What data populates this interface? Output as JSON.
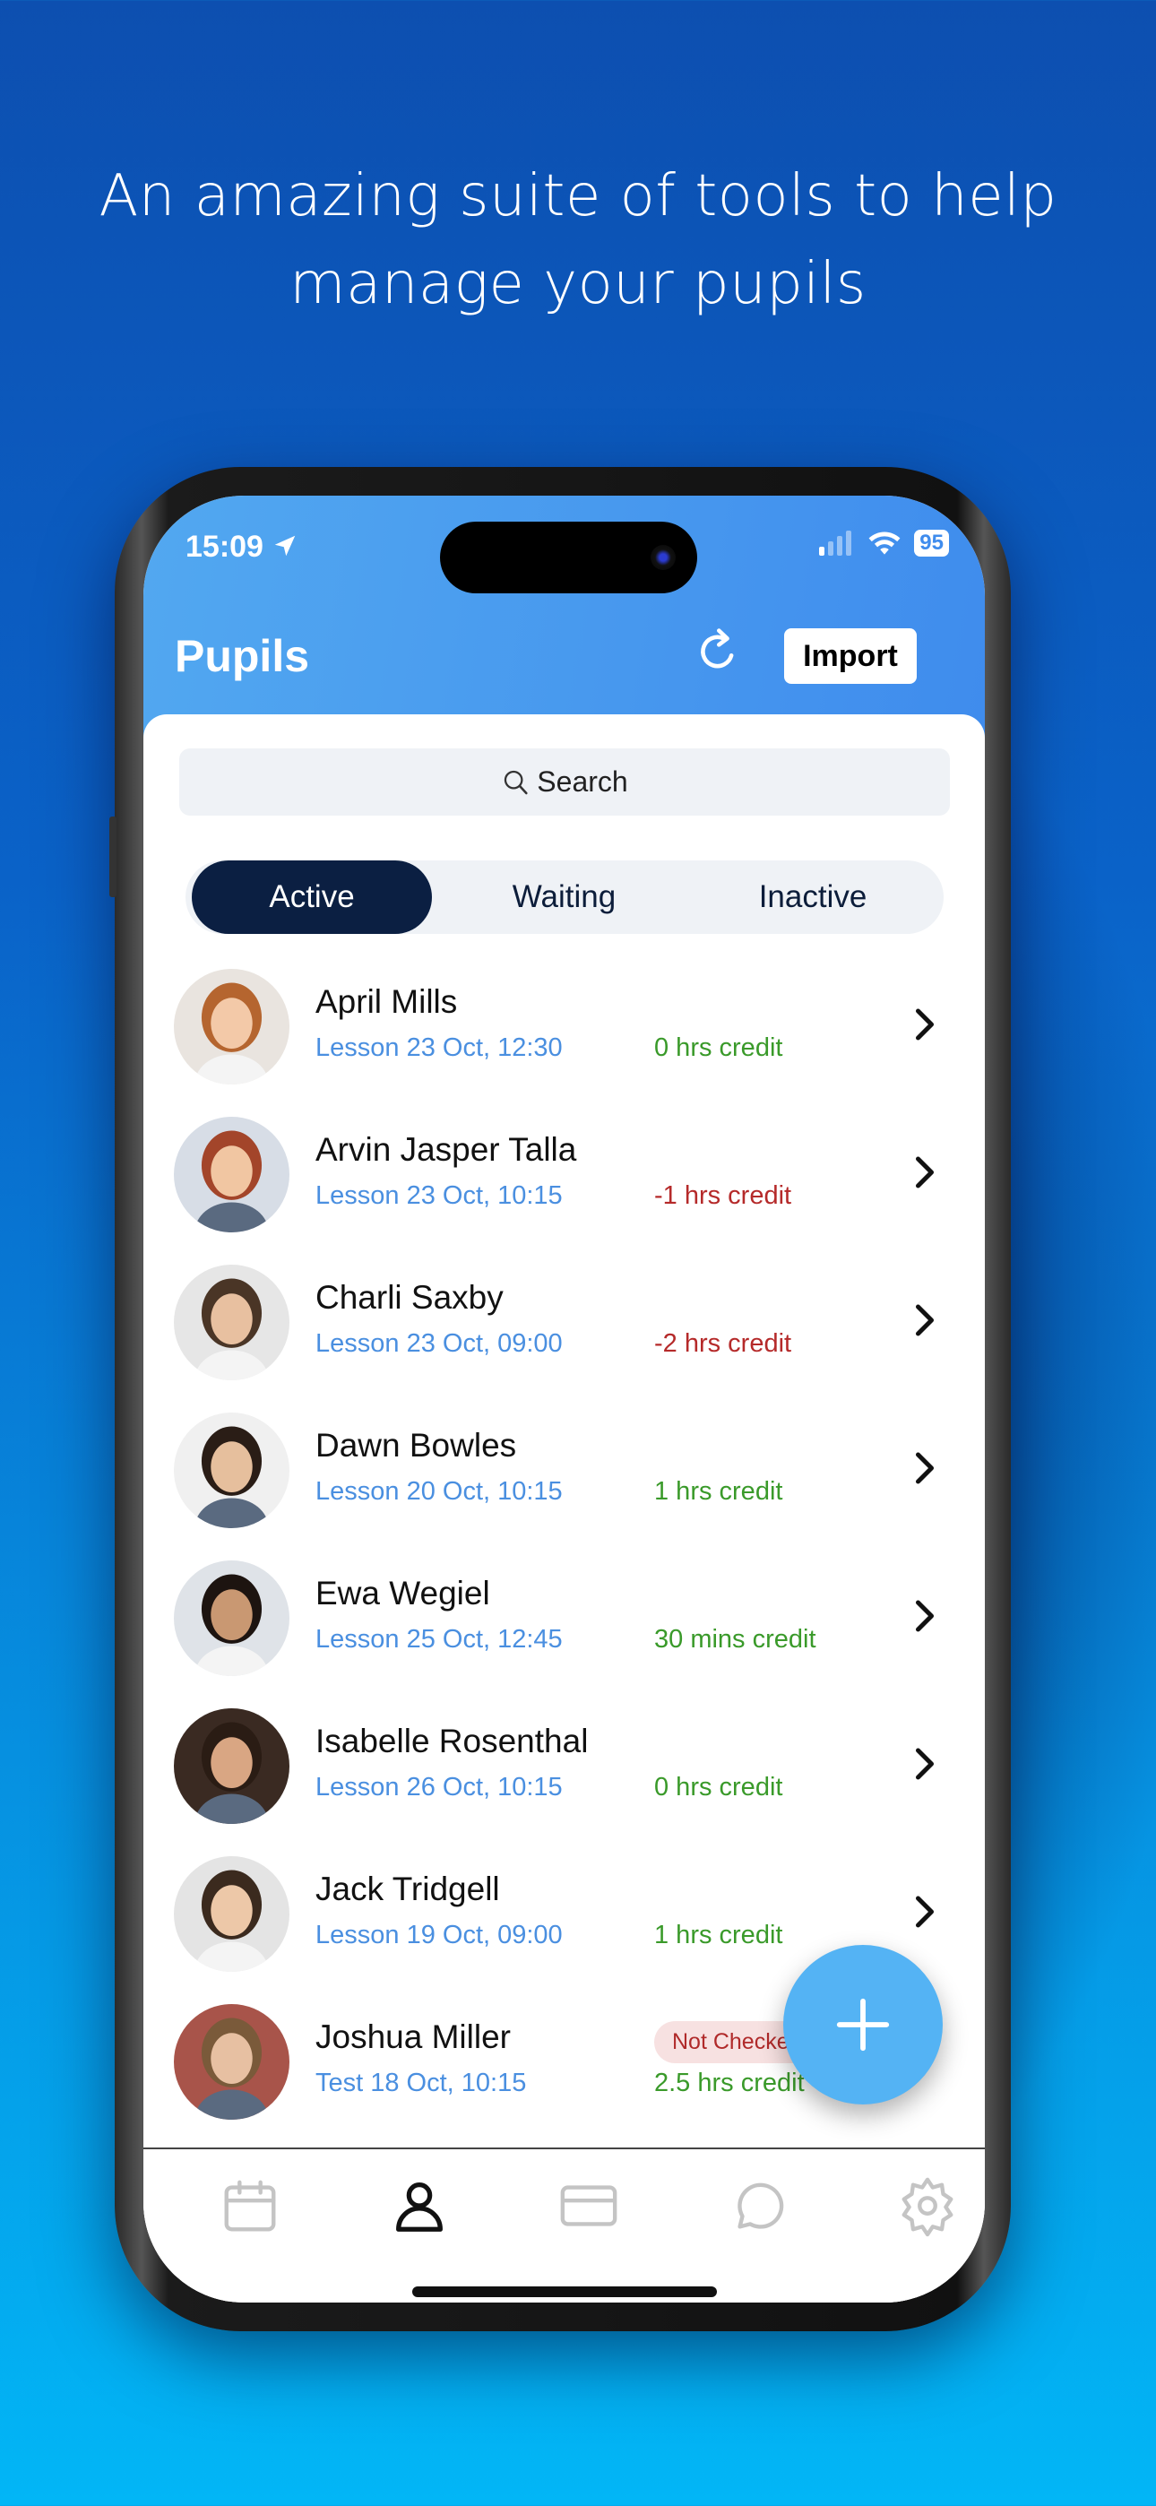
{
  "headline": {
    "line1": "An amazing suite of tools to help",
    "line2": "manage your pupils"
  },
  "status_bar": {
    "time": "15:09",
    "battery": "95"
  },
  "header": {
    "title": "Pupils",
    "import_label": "Import"
  },
  "search": {
    "placeholder": "Search"
  },
  "segments": {
    "items": [
      "Active",
      "Waiting",
      "Inactive"
    ],
    "selected": "Active"
  },
  "pupils": [
    {
      "name": "April Mills",
      "lesson": "Lesson 23 Oct, 12:30",
      "credit": "0 hrs credit",
      "credit_color": "#3a9a2a"
    },
    {
      "name": "Arvin Jasper Talla",
      "lesson": "Lesson 23 Oct, 10:15",
      "credit": "-1 hrs credit",
      "credit_color": "#b52a2a"
    },
    {
      "name": "Charli Saxby",
      "lesson": "Lesson 23 Oct, 09:00",
      "credit": "-2 hrs credit",
      "credit_color": "#b52a2a"
    },
    {
      "name": "Dawn Bowles",
      "lesson": "Lesson 20 Oct, 10:15",
      "credit": "1 hrs credit",
      "credit_color": "#3a9a2a"
    },
    {
      "name": "Ewa Wegiel",
      "lesson": "Lesson 25 Oct, 12:45",
      "credit": "30 mins credit",
      "credit_color": "#3a9a2a"
    },
    {
      "name": "Isabelle Rosenthal",
      "lesson": "Lesson 26 Oct, 10:15",
      "credit": "0 hrs credit",
      "credit_color": "#3a9a2a"
    },
    {
      "name": "Jack Tridgell",
      "lesson": "Lesson 19 Oct, 09:00",
      "credit": "1 hrs credit",
      "credit_color": "#3a9a2a"
    },
    {
      "name": "Joshua Miller",
      "lesson": "Test 18 Oct, 10:15",
      "credit": "2.5 hrs credit",
      "credit_color": "#3a9a2a",
      "badge": "Not Checked"
    }
  ],
  "tabbar": {
    "icons": [
      "calendar-icon",
      "person-icon",
      "card-icon",
      "chat-icon",
      "gear-icon"
    ],
    "selected": "person-icon"
  },
  "colors": {
    "header": "#4a9aee",
    "active_segment": "#0b1f42",
    "fab": "#54b3f4",
    "lesson_text": "#4a8fe0"
  }
}
